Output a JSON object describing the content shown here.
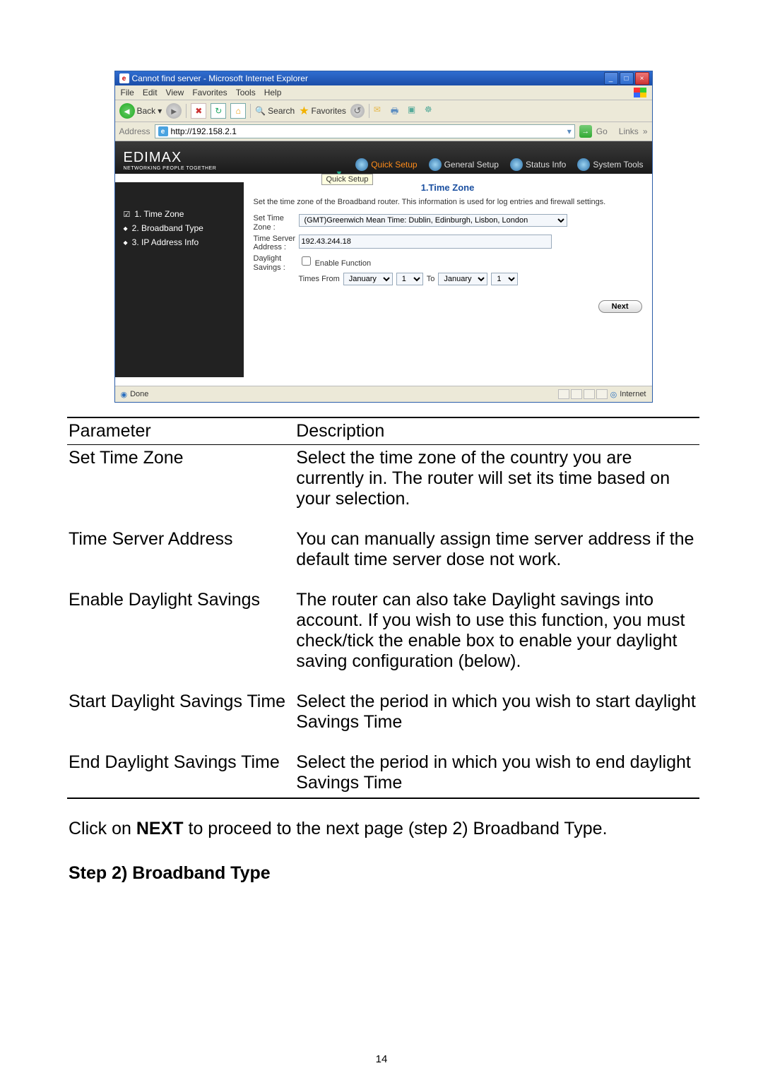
{
  "browser": {
    "title": "Cannot find server - Microsoft Internet Explorer",
    "menus": [
      "File",
      "Edit",
      "View",
      "Favorites",
      "Tools",
      "Help"
    ],
    "back_label": "Back",
    "search_label": "Search",
    "favorites_label": "Favorites",
    "address_label": "Address",
    "url": "http://192.158.2.1",
    "go_label": "Go",
    "links_label": "Links",
    "status_done": "Done",
    "status_zone": "Internet"
  },
  "router": {
    "logo": "EDIMAX",
    "logo_sub": "NETWORKING PEOPLE TOGETHER",
    "tabs": {
      "quick": "Quick Setup",
      "general": "General Setup",
      "status": "Status Info",
      "tools": "System Tools"
    },
    "tooltip": "Quick Setup",
    "sidebar": {
      "item1": "1. Time Zone",
      "item2": "2. Broadband Type",
      "item3": "3. IP Address Info"
    },
    "content": {
      "heading": "1.Time Zone",
      "desc": "Set the time zone of the Broadband router. This information is used for log entries and firewall settings.",
      "labels": {
        "set_tz": "Set Time Zone :",
        "ts_addr": "Time Server Address :",
        "ds": "Daylight Savings :",
        "enable_fn": "Enable Function",
        "times_from": "Times From",
        "to": "To"
      },
      "values": {
        "tz_option": "(GMT)Greenwich Mean Time: Dublin, Edinburgh, Lisbon, London",
        "ts_ip": "192.43.244.18",
        "from_month": "January",
        "from_day": "1",
        "to_month": "January",
        "to_day": "1"
      },
      "next": "Next"
    }
  },
  "doc": {
    "head_param": "Parameter",
    "head_desc": "Description",
    "rows": [
      {
        "p": "Set Time Zone",
        "d": "Select the time zone of the country you are currently in. The router will set its time based on your selection."
      },
      {
        "p": "Time Server Address",
        "d": "You can manually assign time server address if the default time server dose not work."
      },
      {
        "p": "Enable Daylight Savings",
        "d": "The router can also take Daylight savings into account. If you wish to use this function, you must check/tick the enable box to enable your daylight saving configuration (below)."
      },
      {
        "p": "Start Daylight Savings Time",
        "d": "Select the period in which you wish to start daylight Savings Time"
      },
      {
        "p": "End Daylight Savings Time",
        "d": "Select the period in which you wish to end daylight Savings Time"
      }
    ],
    "after_pre": "Click on ",
    "after_bold": "NEXT",
    "after_post": " to proceed to the next page (step 2) Broadband Type.",
    "step2": "Step 2) Broadband Type",
    "page_number": "14"
  }
}
